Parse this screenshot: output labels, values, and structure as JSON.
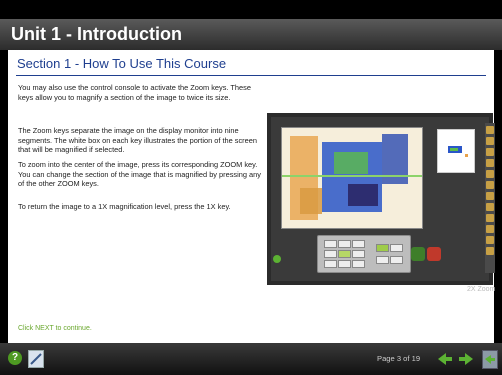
{
  "header": {
    "title": "Unit 1 - Introduction"
  },
  "section": {
    "title": "Section 1 - How To Use This Course"
  },
  "paragraphs": [
    "You may also use the control console to activate the Zoom keys. These keys allow you to magnify a section of the image to twice its size.",
    "The Zoom keys separate the image on the display monitor into nine segments. The white box on each key illustrates the portion of the screen that will be magnified if selected.",
    "To zoom into the center of the image, press its corresponding ZOOM key. You can change the section of the image that is magnified by pressing any of the other ZOOM keys.",
    "To return the image to a 1X magnification level, press the 1X key."
  ],
  "continue_text": "Click NEXT to continue.",
  "image_caption": "2X Zoom",
  "footer": {
    "page": "Page 3 of 19"
  },
  "icons": {
    "help": "help-icon",
    "notes": "notes-icon",
    "back": "back-arrow-icon",
    "next": "next-arrow-icon",
    "exit": "exit-icon"
  },
  "colors": {
    "accent": "#1f3f8f",
    "continue": "#6aa82e",
    "nav": "#5cb233"
  }
}
